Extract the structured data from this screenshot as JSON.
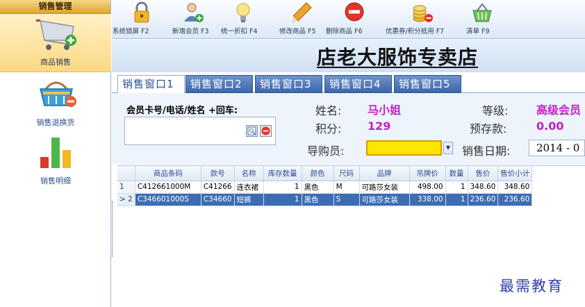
{
  "sidebar": {
    "header": "销售管理",
    "items": [
      {
        "label": "商品销售",
        "icon": "shopping-cart-icon",
        "active": true
      },
      {
        "label": "销售退换货",
        "icon": "return-basket-icon",
        "active": false
      },
      {
        "label": "销售明细",
        "icon": "bar-chart-icon",
        "active": false
      }
    ]
  },
  "toolbar": {
    "buttons": [
      {
        "label": "系统锁屏 F2",
        "icon": "padlock-icon"
      },
      {
        "label": "新增会员 F3",
        "icon": "add-member-icon"
      },
      {
        "label": "统一折扣 F4",
        "icon": "lightbulb-icon"
      },
      {
        "label": "修改商品 F5",
        "icon": "pencil-icon"
      },
      {
        "label": "删除商品 F6",
        "icon": "delete-icon"
      },
      {
        "label": "优惠券/积分抵用 F7",
        "icon": "coins-icon"
      },
      {
        "label": "清单 F9",
        "icon": "basket-icon"
      }
    ]
  },
  "store_name": "店老大服饰专卖店",
  "tabs": [
    "销售窗口1",
    "销售窗口2",
    "销售窗口3",
    "销售窗口4",
    "销售窗口5"
  ],
  "member": {
    "label": "会员卡号/电话/姓名 +回车:",
    "value": ""
  },
  "info": {
    "name_label": "姓名:",
    "name_value": "马小姐",
    "points_label": "积分:",
    "points_value": "129",
    "level_label": "等级:",
    "level_value": "高级会员",
    "prepaid_label": "预存款:",
    "prepaid_value": "0.00",
    "guide_label": "导购员:",
    "guide_value": "",
    "date_label": "销售日期:",
    "date_value": "2014 - 0"
  },
  "grid": {
    "headers": [
      "",
      "商品条码",
      "款号",
      "名称",
      "库存数量",
      "颜色",
      "尺码",
      "品牌",
      "吊牌价",
      "数量",
      "售价",
      "售价小计"
    ],
    "rows": [
      {
        "marker": "1",
        "cells": [
          "C412661000M",
          "C41266",
          "连衣裙",
          "1",
          "黑色",
          "M",
          "可路莎女装",
          "498.00",
          "1",
          "348.60",
          "348.60"
        ],
        "selected": false
      },
      {
        "marker": "> 2",
        "cells": [
          "C346601000S",
          "C34660",
          "短裤",
          "1",
          "黑色",
          "S",
          "可路莎女装",
          "338.00",
          "1",
          "236.60",
          "236.60"
        ],
        "selected": true
      }
    ]
  },
  "watermark": "最需教育"
}
